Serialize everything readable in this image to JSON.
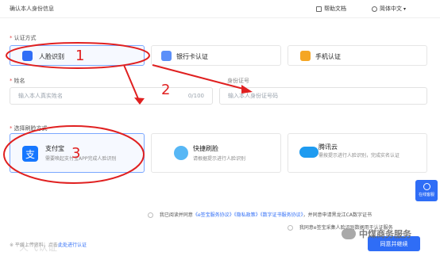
{
  "header": {
    "title": "确认本人身份信息",
    "help_label": "帮助文档",
    "lang_label": "简体中文"
  },
  "auth_method": {
    "label": "认证方式",
    "options": [
      {
        "label": "人脸识别"
      },
      {
        "label": "银行卡认证"
      },
      {
        "label": "手机认证"
      }
    ]
  },
  "form": {
    "name_label": "姓名",
    "name_placeholder": "输入本人真实姓名",
    "name_counter": "0/100",
    "id_label": "身份证号",
    "id_placeholder": "输入本人身份证号码"
  },
  "face_method": {
    "label": "选择刷脸方式",
    "options": [
      {
        "title": "支付宝",
        "desc": "需要唤起支付宝APP完成人脸识别"
      },
      {
        "title": "快捷刷脸",
        "desc": "请根据提示进行人脸识别"
      },
      {
        "title": "腾讯云",
        "desc": "需按提示进行人脸识别，完成实名认证"
      }
    ]
  },
  "agreement": {
    "line1_prefix": "我已阅读并同意",
    "line1_links": [
      "《e签宝服务协议》",
      "《隐私政策》",
      "《数字证书服务协议》"
    ],
    "line1_suffix": "，并同意申请黑龙江CA数字证书",
    "line2": "我同意e签宝采集人脸识别数据用于认证服务"
  },
  "footer": {
    "left_text": "※ 平缓上传资料，点击",
    "left_link": "此处进行认证",
    "submit_label": "同意并继续"
  },
  "floating": {
    "help_label": "在线客服"
  },
  "annotations": {
    "n1": "1",
    "n2": "2",
    "n3": "3"
  },
  "watermark": {
    "text": "中煤商务服务",
    "left_text": "火飞认证"
  },
  "colors": {
    "accent": "#2f6df6",
    "annotation_red": "#e02020",
    "selected_border": "#7aa7ff"
  },
  "icons": {
    "help": "help-doc-icon",
    "language": "globe-icon",
    "face": "face-scan-icon",
    "bank": "bank-card-icon",
    "phone": "phone-icon",
    "alipay": "alipay-icon",
    "quick_face": "quick-face-icon",
    "tencent": "tencent-cloud-icon",
    "wechat": "wechat-icon"
  }
}
